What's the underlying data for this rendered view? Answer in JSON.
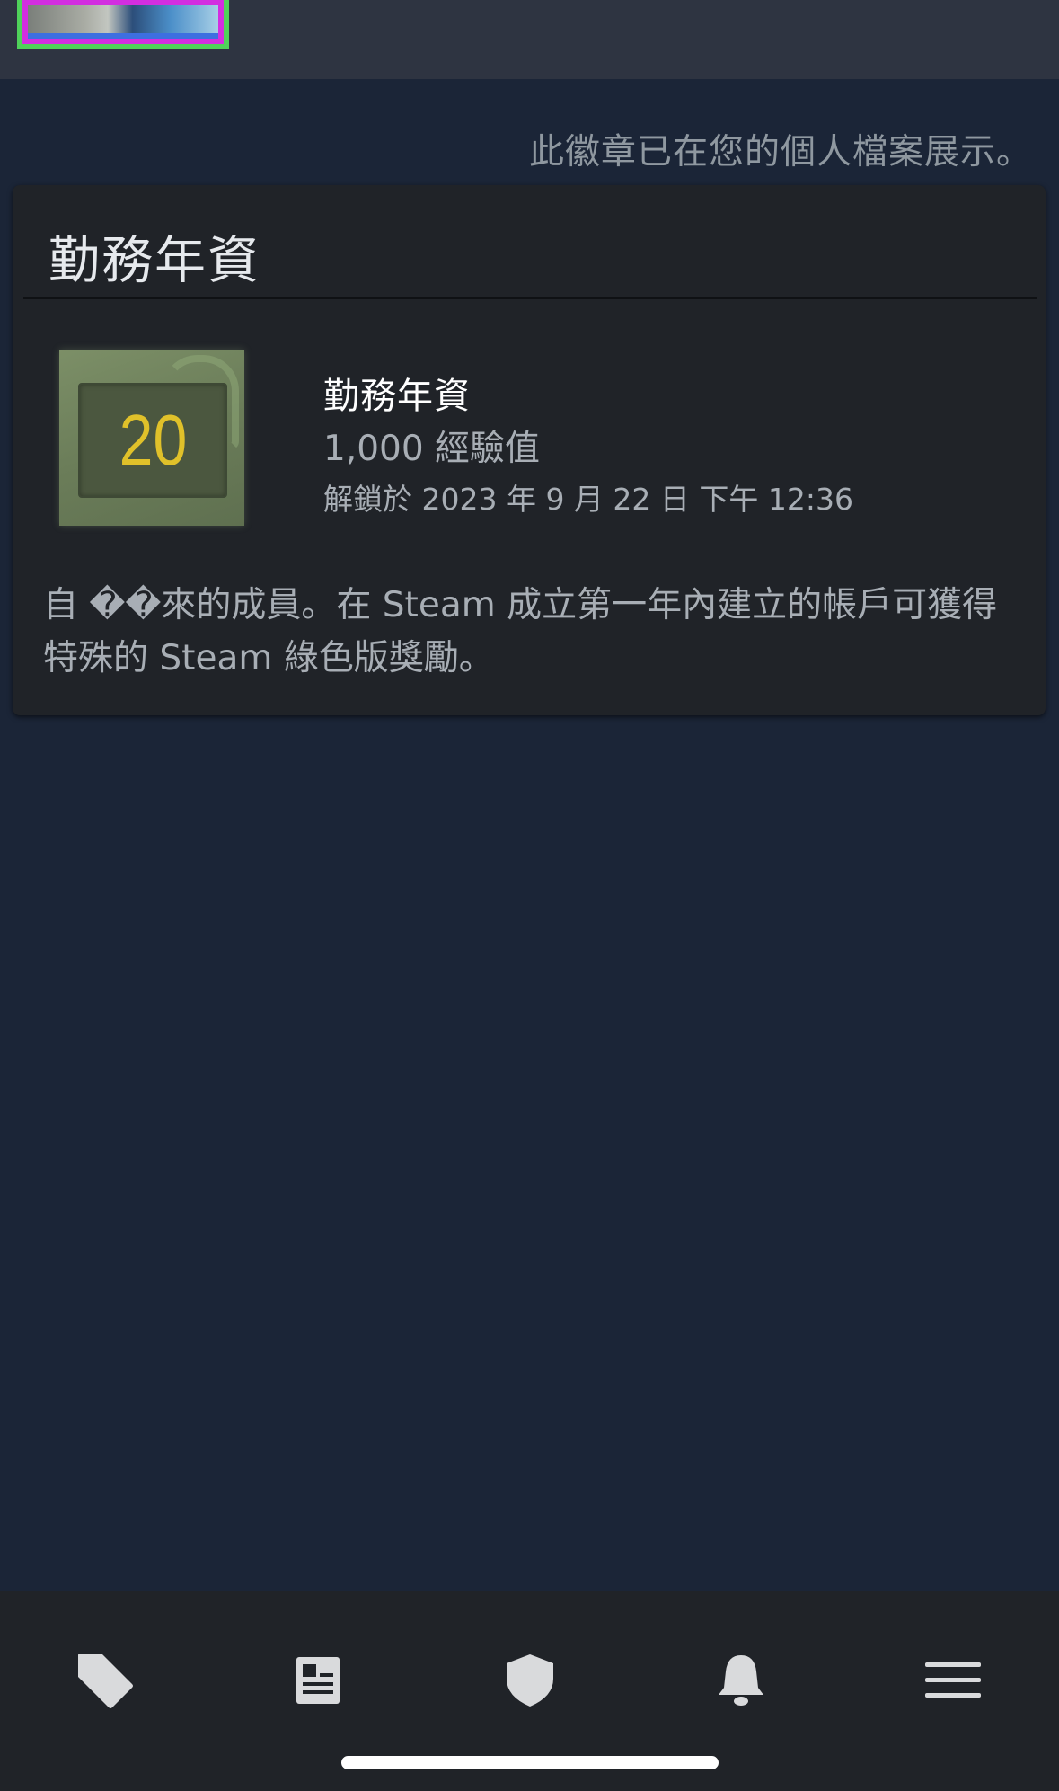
{
  "showcase_note": "此徽章已在您的個人檔案展示。",
  "badge": {
    "card_title": "勤務年資",
    "level": "20",
    "name": "勤務年資",
    "xp": "1,000 經驗值",
    "unlocked": "解鎖於 2023 年 9 月 22 日 下午 12:36",
    "description": "自 ��來的成員。在 Steam 成立第一年內建立的帳戶可獲得特殊的 Steam 綠色版獎勵。"
  },
  "tabs": [
    {
      "icon": "tag-icon"
    },
    {
      "icon": "news-icon"
    },
    {
      "icon": "shield-icon"
    },
    {
      "icon": "bell-icon"
    },
    {
      "icon": "menu-icon"
    }
  ],
  "colors": {
    "background": "#1b2537",
    "card": "#202328",
    "header": "#2e3441",
    "badge_level": "#e0c12a",
    "avatar_outer_frame": "#4fd15a",
    "avatar_inner_frame": "#d22ee0"
  }
}
